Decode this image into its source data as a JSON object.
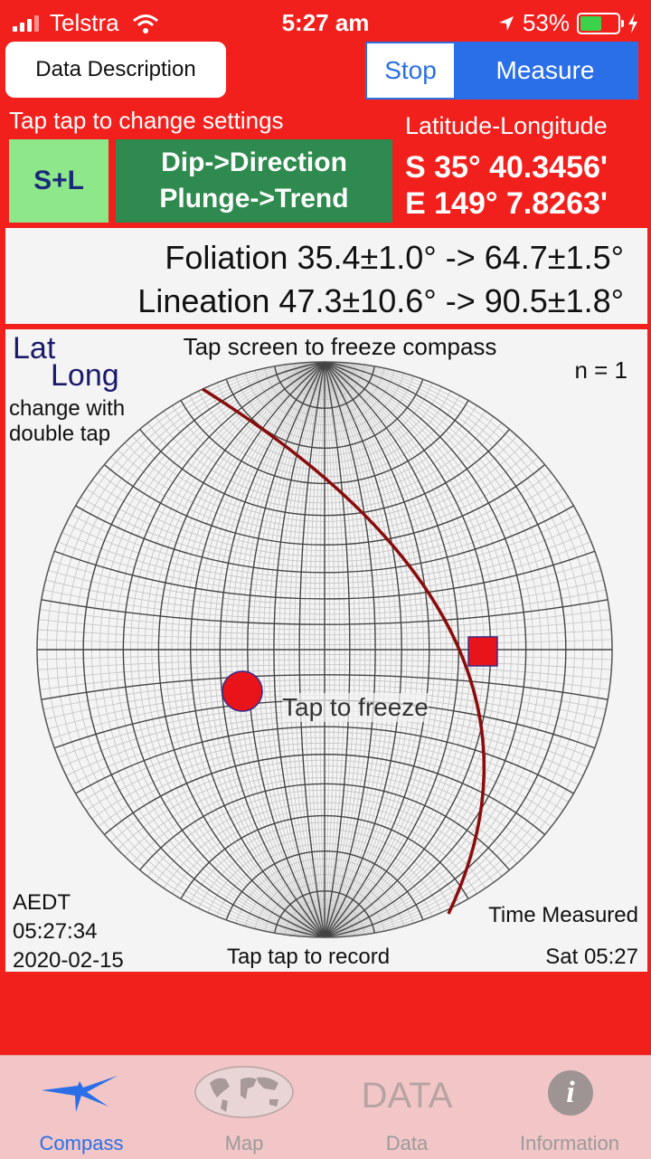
{
  "status": {
    "carrier": "Telstra",
    "time": "5:27 am",
    "battery": "53%"
  },
  "header": {
    "data_description": "Data Description",
    "stop": "Stop",
    "measure": "Measure",
    "tap_settings": "Tap tap to change settings",
    "latlon_label": "Latitude-Longitude",
    "sl_button": "S+L",
    "dip_line1": "Dip->Direction",
    "dip_line2": "Plunge->Trend",
    "coord_lat": "S 35° 40.3456'",
    "coord_lon": "E 149° 7.8263'"
  },
  "results": {
    "foliation": "Foliation  35.4±1.0° -> 64.7±1.5°",
    "lineation": "Lineation  47.3±10.6° -> 90.5±1.8°"
  },
  "stereonet": {
    "lat": "Lat",
    "long": "Long",
    "change_hint": "change with double tap",
    "freeze_top": "Tap screen to freeze compass",
    "n_count": "n =  1",
    "tap_freeze": "Tap to freeze",
    "tz": "AEDT",
    "time": "05:27:34",
    "date": "2020-02-15",
    "record": "Tap tap to record",
    "time_measured": "Time Measured",
    "sat_time": "Sat 05:27"
  },
  "tabs": [
    {
      "label": "Compass",
      "icon": "compass-star-icon",
      "active": true
    },
    {
      "label": "Map",
      "icon": "world-map-icon",
      "active": false
    },
    {
      "label": "Data",
      "icon": "data-text-icon",
      "word": "DATA",
      "active": false
    },
    {
      "label": "Information",
      "icon": "info-icon",
      "active": false
    }
  ],
  "colors": {
    "background": "#f2201d",
    "accent": "#2a6fe8",
    "green_light": "#8ee88a",
    "green_dark": "#2e8a4e",
    "plane": "#8a0d0d",
    "marker": "#e8141a"
  }
}
